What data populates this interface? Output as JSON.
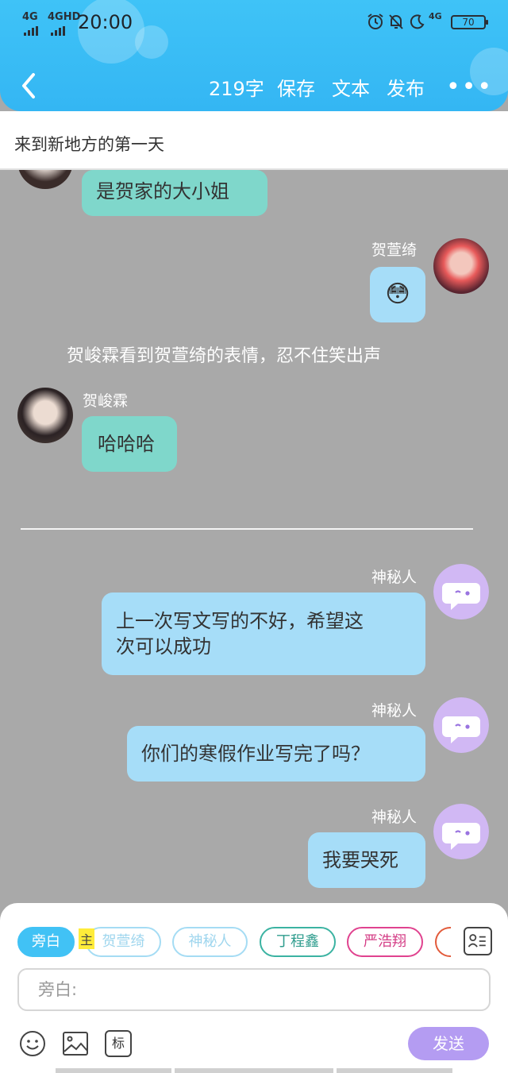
{
  "status_bar": {
    "signal1": "4G",
    "signal2": "4GHD",
    "time": "20:00",
    "net_badge": "4G",
    "battery": "70"
  },
  "toolbar": {
    "word_count": "219字",
    "save": "保存",
    "text": "文本",
    "publish": "发布",
    "more": "•••"
  },
  "story_title": "来到新地方的第一天",
  "messages": {
    "m1": {
      "text": "是贺家的大小姐"
    },
    "m2": {
      "speaker": "贺萱绮",
      "emoji": "😳"
    },
    "narration": "贺峻霖看到贺萱绮的表情，忍不住笑出声",
    "m3": {
      "speaker": "贺峻霖",
      "text": "哈哈哈"
    },
    "m4": {
      "speaker": "神秘人",
      "line1": "上一次写文写的不好，希望这",
      "line2": "次可以成功"
    },
    "m5": {
      "speaker": "神秘人",
      "text": "你们的寒假作业写完了吗？"
    },
    "m6": {
      "speaker": "神秘人",
      "text": "我要哭死"
    }
  },
  "composer": {
    "chips": [
      "旁白",
      "贺萱绮",
      "神秘人",
      "丁程鑫",
      "严浩翔"
    ],
    "main_mark": "主",
    "input_placeholder": "旁白:",
    "tag_label": "标",
    "send": "发送"
  },
  "colors": {
    "header": "#3fc3f7",
    "chat_bg": "#a9a9a9",
    "green_bubble": "#7fd7cb",
    "blue_bubble": "#a6ddf8",
    "send": "#b49cf2",
    "chip_active": "#41c2f5",
    "chip_xuanqi": "#a5dcf4",
    "chip_shenmi": "#a5dcf4",
    "chip_ding": "#3bb3a2",
    "chip_yan": "#e0438f"
  }
}
